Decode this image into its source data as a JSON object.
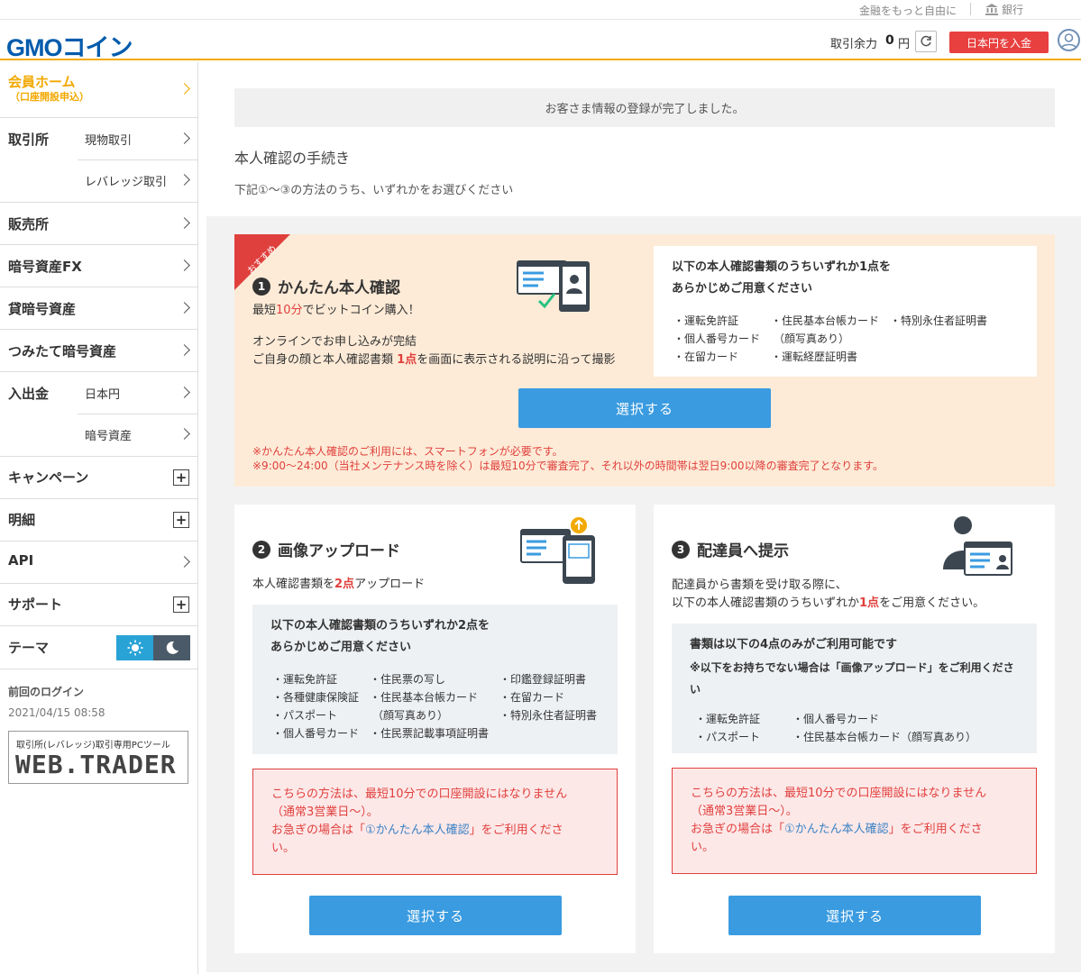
{
  "topbar": {
    "tagline": "金融をもっと自由に",
    "bank_label": "銀行"
  },
  "header": {
    "logo_text": "GMOコイン",
    "balance_label": "取引余力",
    "balance_value": "0",
    "balance_unit": "円",
    "deposit_button": "日本円を入金"
  },
  "sidebar": {
    "home_label": "会員ホーム",
    "home_sub": "（口座開設申込）",
    "exchange": "取引所",
    "exchange_spot": "現物取引",
    "exchange_leverage": "レバレッジ取引",
    "sales": "販売所",
    "fx": "暗号資産FX",
    "lending": "貸暗号資産",
    "tsumitate": "つみたて暗号資産",
    "deposit": "入出金",
    "deposit_jpy": "日本円",
    "deposit_crypto": "暗号資産",
    "campaign": "キャンペーン",
    "statement": "明細",
    "api": "API",
    "support": "サポート",
    "theme": "テーマ",
    "last_login_label": "前回のログイン",
    "last_login_value": "2021/04/15 08:58",
    "webtrader_caption": "取引所(レバレッジ)取引専用PCツール",
    "webtrader_logo": "WEB.TRADER"
  },
  "main": {
    "notice": "お客さま情報の登録が完了しました。",
    "title": "本人確認の手続き",
    "desc": "下記①～③の方法のうち、いずれかをお選びください"
  },
  "card1": {
    "ribbon": "おすすめ",
    "num": "1",
    "title": "かんたん本人確認",
    "line1_pre": "最短",
    "line1_hl": "10分",
    "line1_post": "でビットコイン購入！",
    "line2": "オンラインでお申し込みが完結",
    "line3_pre": "ご自身の顔と本人確認書類",
    "line3_hl": "1点",
    "line3_post": "を画面に表示される説明に沿って撮影",
    "box_head1": "以下の本人確認書類のうちいずれか1点を",
    "box_head2": "あらかじめご用意ください",
    "docs": [
      "・運転免許証",
      "・個人番号カード",
      "・在留カード",
      "・住民基本台帳カード",
      "（顔写真あり）",
      "・運転経歴証明書",
      "・特別永住者証明書"
    ],
    "button": "選択する",
    "note1": "※かんたん本人確認のご利用には、スマートフォンが必要です。",
    "note2": "※9:00～24:00（当社メンテナンス時を除く）は最短10分で審査完了、それ以外の時間帯は翌日9:00以降の審査完了となります。"
  },
  "card2": {
    "num": "2",
    "title": "画像アップロード",
    "line_pre": "本人確認書類を",
    "line_hl": "2点",
    "line_post": "アップロード",
    "box_head1": "以下の本人確認書類のうちいずれか2点を",
    "box_head2": "あらかじめご用意ください",
    "docs": [
      "・運転免許証",
      "・各種健康保険証",
      "・パスポート",
      "・個人番号カード",
      "・住民票の写し",
      "・住民基本台帳カード",
      "（顔写真あり）",
      "・住民票記載事項証明書",
      "・印鑑登録証明書",
      "・在留カード",
      "・特別永住者証明書"
    ],
    "warn1": "こちらの方法は、最短10分での口座開設にはなりません",
    "warn2": "（通常3営業日～）。",
    "warn3": "お急ぎの場合は「",
    "warn_link": "①かんたん本人確認",
    "warn4": "」をご利用くださ",
    "warn5": "い。",
    "button": "選択する"
  },
  "card3": {
    "num": "3",
    "title": "配達員へ提示",
    "line1": "配達員から書類を受け取る際に、",
    "line2_pre": "以下の本人確認書類のうちいずれか",
    "line2_hl": "1点",
    "line2_post": "をご用意ください。",
    "box_head1": "書類は以下の4点のみがご利用可能です",
    "box_head2": "※以下をお持ちでない場合は「画像アップロード」をご利用くださ",
    "box_head3": "い",
    "docs": [
      "・運転免許証",
      "・パスポート",
      "・個人番号カード",
      "・住民基本台帳カード（顔写真あり）"
    ],
    "warn1": "こちらの方法は、最短10分での口座開設にはなりません",
    "warn2": "（通常3営業日～）。",
    "warn3": "お急ぎの場合は「",
    "warn_link": "①かんたん本人確認",
    "warn4": "」をご利用くださ",
    "warn5": "い。",
    "button": "選択する"
  }
}
